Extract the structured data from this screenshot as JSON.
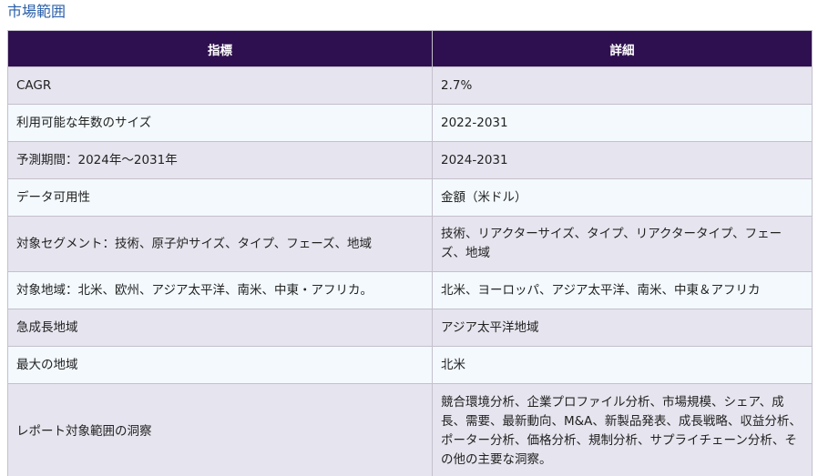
{
  "section_title": "市場範囲",
  "table": {
    "headers": [
      "指標",
      "詳細"
    ],
    "rows": [
      {
        "metric": "CAGR",
        "detail": "2.7%"
      },
      {
        "metric": "利用可能な年数のサイズ",
        "detail": "2022-2031"
      },
      {
        "metric": "予測期間：2024年～2031年",
        "detail": "2024-2031"
      },
      {
        "metric": "データ可用性",
        "detail": "金額（米ドル）"
      },
      {
        "metric": "対象セグメント：技術、原子炉サイズ、タイプ、フェーズ、地域",
        "detail": "技術、リアクターサイズ、タイプ、リアクタータイプ、フェーズ、地域"
      },
      {
        "metric": "対象地域：北米、欧州、アジア太平洋、南米、中東・アフリカ。",
        "detail": "北米、ヨーロッパ、アジア太平洋、南米、中東＆アフリカ"
      },
      {
        "metric": "急成長地域",
        "detail": "アジア太平洋地域"
      },
      {
        "metric": "最大の地域",
        "detail": "北米"
      },
      {
        "metric": "レポート対象範囲の洞察",
        "detail": "競合環境分析、企業プロファイル分析、市場規模、シェア、成長、需要、最新動向、M&A、新製品発表、成長戦略、収益分析、ポーター分析、価格分析、規制分析、サプライチェーン分析、その他の主要な洞察。"
      }
    ]
  }
}
